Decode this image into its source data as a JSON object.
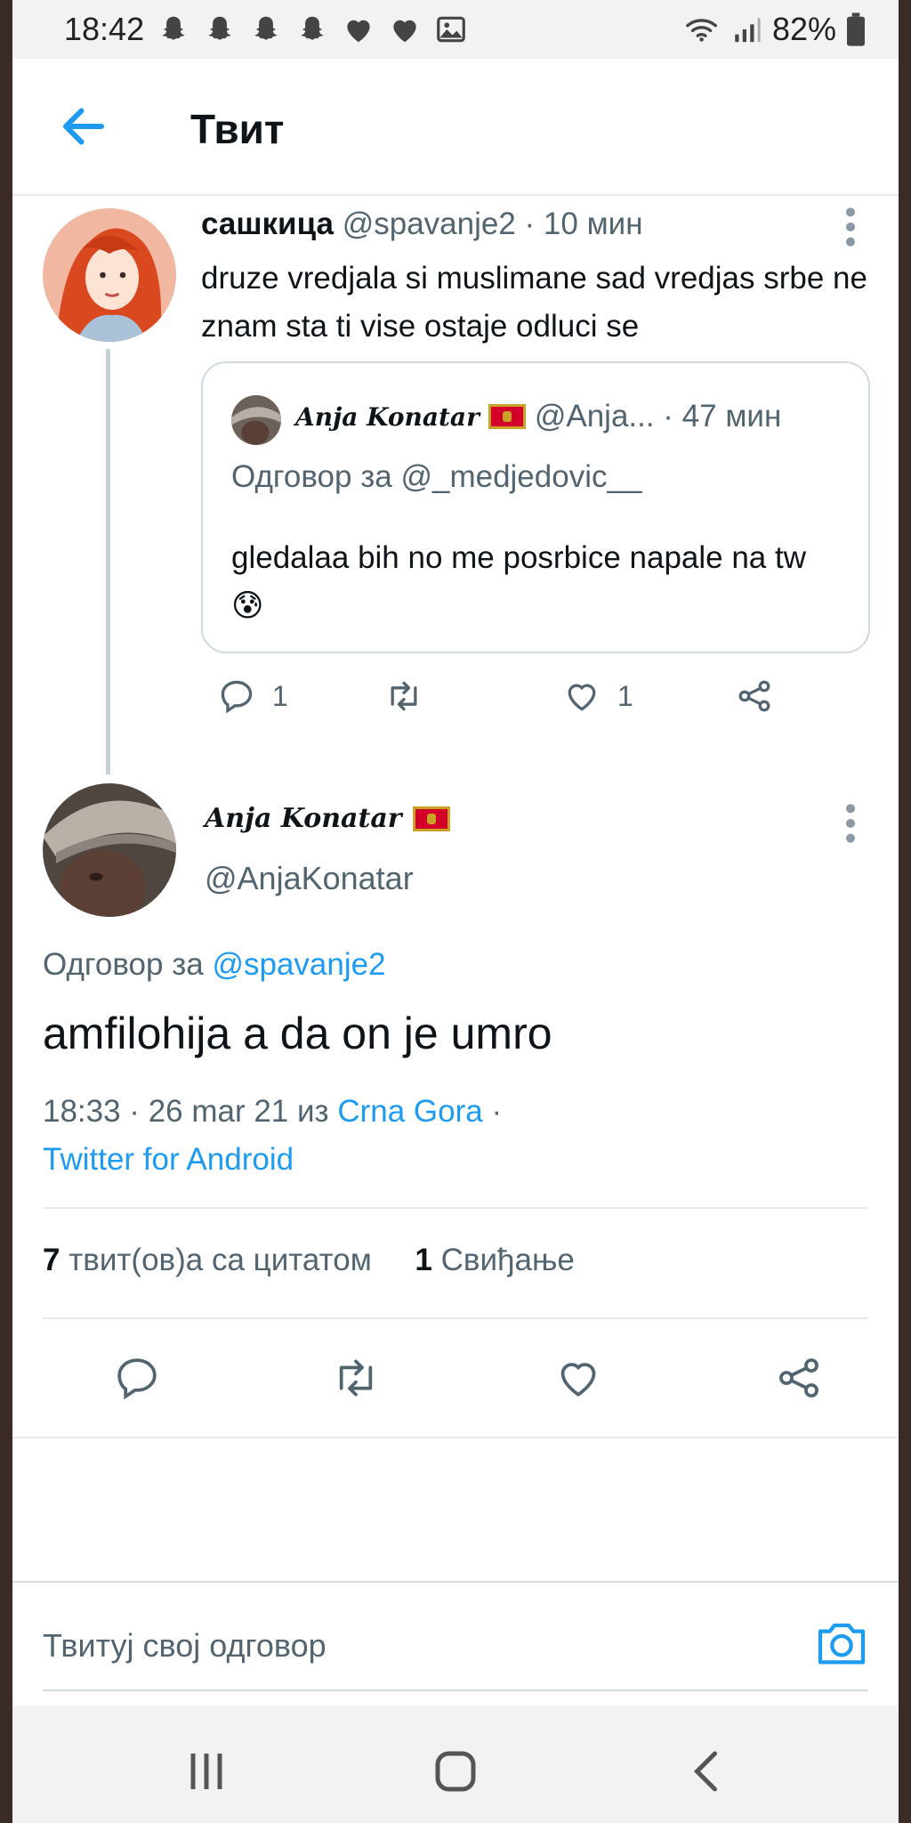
{
  "status_bar": {
    "time": "18:42",
    "notification_icons": [
      "snapchat-icon",
      "snapchat-icon",
      "snapchat-icon",
      "snapchat-icon",
      "heart-icon",
      "heart-icon",
      "image-icon"
    ],
    "battery": "82%"
  },
  "header": {
    "title": "Твит"
  },
  "quoted_reply": {
    "display_name": "сашкица",
    "meta": "@spavanje2 · 10 мин",
    "text": "druze vredjala si muslimane sad vredjas srbe ne znam sta ti vise ostaje odluci se",
    "quote": {
      "display_name": "Anja Konatar",
      "meta": "@Anja... · 47 мин",
      "reply_prefix": "Одговор за",
      "reply_handle": "@_medjedovic__",
      "text": "gledalaa bih no me posrbice napale na tw 😰"
    },
    "actions": {
      "reply_count": "1",
      "like_count": "1"
    }
  },
  "main_tweet": {
    "display_name": "Anja Konatar",
    "handle": "@AnjaKonatar",
    "reply_prefix": "Одговор за",
    "reply_handle": "@spavanje2",
    "text": "amfilohija a da on je umro",
    "timestamp": "18:33 · 26 mar 21 из",
    "location": "Crna Gora",
    "meta_sep": "·",
    "source": "Twitter for Android",
    "stats": {
      "quote_count": "7",
      "quote_label": "твит(ов)а са цитатом",
      "like_count": "1",
      "like_label": "Свиђање"
    }
  },
  "compose": {
    "placeholder": "Твитуј свој одговор"
  },
  "colors": {
    "accent": "#1d9bf0",
    "secondary_text": "#536471",
    "primary_text": "#0f1419",
    "divider": "#e6ecf0"
  }
}
